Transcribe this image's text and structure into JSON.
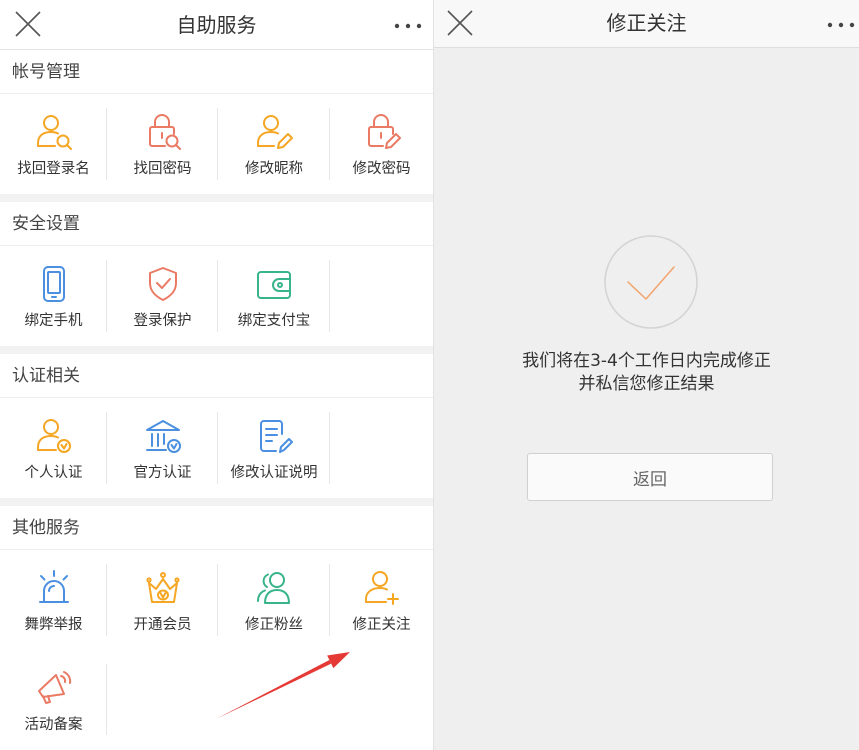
{
  "left": {
    "header": {
      "title": "自助服务",
      "close_icon": "close-icon",
      "more_icon": "more-icon"
    },
    "sections": [
      {
        "title": "帐号管理",
        "items": [
          {
            "label": "找回登录名",
            "icon": "user-search-icon"
          },
          {
            "label": "找回密码",
            "icon": "lock-search-icon"
          },
          {
            "label": "修改昵称",
            "icon": "user-edit-icon"
          },
          {
            "label": "修改密码",
            "icon": "lock-edit-icon"
          }
        ]
      },
      {
        "title": "安全设置",
        "items": [
          {
            "label": "绑定手机",
            "icon": "phone-icon"
          },
          {
            "label": "登录保护",
            "icon": "shield-check-icon"
          },
          {
            "label": "绑定支付宝",
            "icon": "wallet-icon"
          }
        ]
      },
      {
        "title": "认证相关",
        "items": [
          {
            "label": "个人认证",
            "icon": "user-verified-icon"
          },
          {
            "label": "官方认证",
            "icon": "bank-verified-icon"
          },
          {
            "label": "修改认证说明",
            "icon": "document-edit-icon"
          }
        ]
      },
      {
        "title": "其他服务",
        "items": [
          {
            "label": "舞弊举报",
            "icon": "siren-icon"
          },
          {
            "label": "开通会员",
            "icon": "crown-icon"
          },
          {
            "label": "修正粉丝",
            "icon": "users-icon"
          },
          {
            "label": "修正关注",
            "icon": "user-add-icon"
          },
          {
            "label": "活动备案",
            "icon": "megaphone-icon"
          }
        ]
      }
    ]
  },
  "right": {
    "header": {
      "title": "修正关注",
      "close_icon": "close-icon",
      "more_icon": "more-icon"
    },
    "status_icon": "check-circle-icon",
    "message": {
      "line1": "我们将在3-4个工作日内完成修正",
      "line2": "并私信您修正结果"
    },
    "back_button": "返回"
  },
  "annotation": {
    "icon": "red-arrow-icon",
    "points_to": "修正关注"
  },
  "colors": {
    "orange": "#f5a623",
    "red": "#ea7a64",
    "blue": "#4a8fe0",
    "green": "#38b48b",
    "arrow": "#e53935",
    "check": "#f3a46c"
  }
}
